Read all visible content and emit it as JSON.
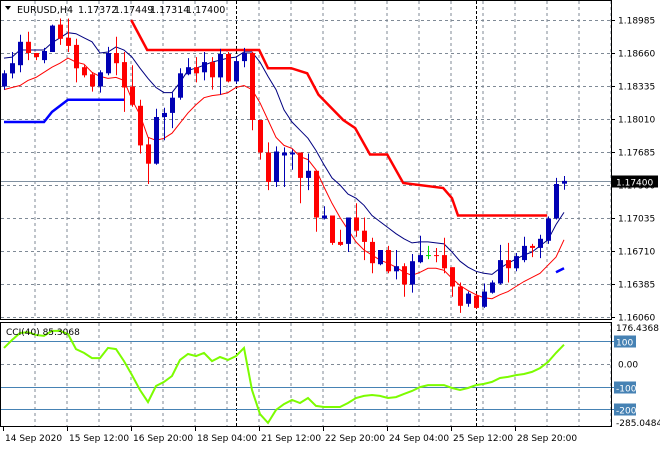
{
  "header": {
    "symbol": "EURUSD,H4",
    "open": "1.17372",
    "high": "1.17449",
    "low": "1.17314",
    "close": "1.17400"
  },
  "colors": {
    "bull": "#0000b4",
    "bear": "#ff0000",
    "doji": "#00e000",
    "ma_fast": "#000080",
    "ma_slow": "#ff0000",
    "stop_red": "#ff0000",
    "stop_blue": "#0000ff",
    "cci": "#7cfc00",
    "cci_levels": "#4682b4",
    "grid": "#7f8a96"
  },
  "chart_data": [
    {
      "type": "candlestick",
      "title": "EURUSD,H4",
      "price_ticks": [
        "1.18985",
        "1.18660",
        "1.18335",
        "1.18010",
        "1.17685",
        "1.17360",
        "1.17035",
        "1.16710",
        "1.16385",
        "1.16060"
      ],
      "ylim": [
        1.1603,
        1.1917
      ],
      "current_price_label": "1.17400",
      "current_price": 1.174,
      "x_labels": [
        {
          "index": 0,
          "text": "14 Sep 2020"
        },
        {
          "index": 8,
          "text": "15 Sep 12:00"
        },
        {
          "index": 16,
          "text": "16 Sep 20:00"
        },
        {
          "index": 24,
          "text": "18 Sep 04:00"
        },
        {
          "index": 32,
          "text": "21 Sep 12:00"
        },
        {
          "index": 40,
          "text": "22 Sep 20:00"
        },
        {
          "index": 48,
          "text": "24 Sep 04:00"
        },
        {
          "index": 56,
          "text": "25 Sep 12:00"
        },
        {
          "index": 64,
          "text": "28 Sep 20:00"
        }
      ],
      "period_separators": [
        29,
        59
      ],
      "ohlc": [
        [
          1.1833,
          1.1849,
          1.183,
          1.1846
        ],
        [
          1.1846,
          1.1867,
          1.1841,
          1.1856
        ],
        [
          1.1854,
          1.1884,
          1.1847,
          1.1877
        ],
        [
          1.1877,
          1.1887,
          1.1859,
          1.1866
        ],
        [
          1.1866,
          1.1866,
          1.1859,
          1.1862
        ],
        [
          1.1859,
          1.1871,
          1.1856,
          1.1868
        ],
        [
          1.1867,
          1.1894,
          1.1867,
          1.1893
        ],
        [
          1.1894,
          1.19,
          1.1874,
          1.188
        ],
        [
          1.1881,
          1.19,
          1.1867,
          1.1873
        ],
        [
          1.1874,
          1.188,
          1.1837,
          1.1851
        ],
        [
          1.1852,
          1.1854,
          1.1842,
          1.1844
        ],
        [
          1.1845,
          1.1847,
          1.1828,
          1.1833
        ],
        [
          1.1833,
          1.1849,
          1.1827,
          1.1847
        ],
        [
          1.1846,
          1.1872,
          1.1844,
          1.1866
        ],
        [
          1.1866,
          1.1882,
          1.1844,
          1.1856
        ],
        [
          1.1857,
          1.1867,
          1.1808,
          1.1832
        ],
        [
          1.1833,
          1.1854,
          1.1813,
          1.1815
        ],
        [
          1.1814,
          1.182,
          1.1767,
          1.1775
        ],
        [
          1.1776,
          1.1783,
          1.1737,
          1.1757
        ],
        [
          1.1757,
          1.1811,
          1.1756,
          1.1803
        ],
        [
          1.1803,
          1.1812,
          1.178,
          1.1807
        ],
        [
          1.1807,
          1.1827,
          1.1792,
          1.1822
        ],
        [
          1.1822,
          1.1851,
          1.182,
          1.1846
        ],
        [
          1.1845,
          1.1861,
          1.1844,
          1.1852
        ],
        [
          1.1852,
          1.1862,
          1.1837,
          1.1846
        ],
        [
          1.1847,
          1.1867,
          1.1839,
          1.1857
        ],
        [
          1.1857,
          1.1862,
          1.183,
          1.1842
        ],
        [
          1.1842,
          1.187,
          1.1825,
          1.1865
        ],
        [
          1.1865,
          1.1867,
          1.1837,
          1.1838
        ],
        [
          1.1838,
          1.1862,
          1.1836,
          1.1858
        ],
        [
          1.1858,
          1.1871,
          1.1852,
          1.1866
        ],
        [
          1.1866,
          1.1867,
          1.179,
          1.18
        ],
        [
          1.18,
          1.18,
          1.1761,
          1.1768
        ],
        [
          1.1768,
          1.1778,
          1.1731,
          1.1739
        ],
        [
          1.1739,
          1.1774,
          1.1734,
          1.1769
        ],
        [
          1.1765,
          1.1773,
          1.1734,
          1.1768
        ],
        [
          1.1766,
          1.1771,
          1.1751,
          1.1768
        ],
        [
          1.1768,
          1.1768,
          1.1718,
          1.1743
        ],
        [
          1.1743,
          1.1767,
          1.1731,
          1.175
        ],
        [
          1.175,
          1.175,
          1.169,
          1.1704
        ],
        [
          1.1703,
          1.1715,
          1.1702,
          1.1706
        ],
        [
          1.1706,
          1.1706,
          1.1677,
          1.1679
        ],
        [
          1.168,
          1.1692,
          1.1676,
          1.1677
        ],
        [
          1.1678,
          1.1704,
          1.167,
          1.1704
        ],
        [
          1.1704,
          1.1718,
          1.1685,
          1.1691
        ],
        [
          1.1691,
          1.1704,
          1.1662,
          1.168
        ],
        [
          1.168,
          1.1684,
          1.1649,
          1.1659
        ],
        [
          1.1658,
          1.1672,
          1.1657,
          1.1672
        ],
        [
          1.1672,
          1.1676,
          1.1649,
          1.1651
        ],
        [
          1.1651,
          1.1672,
          1.1643,
          1.1656
        ],
        [
          1.1656,
          1.1659,
          1.1626,
          1.1638
        ],
        [
          1.1638,
          1.1668,
          1.163,
          1.1661
        ],
        [
          1.166,
          1.1686,
          1.1659,
          1.1667
        ],
        [
          1.1667,
          1.1676,
          1.1663,
          1.1667
        ],
        [
          1.1667,
          1.1674,
          1.166,
          1.1666
        ],
        [
          1.1667,
          1.1684,
          1.1649,
          1.1654
        ],
        [
          1.1655,
          1.1655,
          1.1626,
          1.1636
        ],
        [
          1.1636,
          1.164,
          1.161,
          1.1617
        ],
        [
          1.1619,
          1.1631,
          1.1616,
          1.1629
        ],
        [
          1.1627,
          1.1629,
          1.1614,
          1.1615
        ],
        [
          1.1616,
          1.1639,
          1.1615,
          1.1631
        ],
        [
          1.163,
          1.1642,
          1.1629,
          1.164
        ],
        [
          1.1639,
          1.1677,
          1.1638,
          1.1662
        ],
        [
          1.1662,
          1.1679,
          1.164,
          1.1654
        ],
        [
          1.1654,
          1.1669,
          1.1651,
          1.1666
        ],
        [
          1.1662,
          1.1685,
          1.166,
          1.1676
        ],
        [
          1.1676,
          1.1678,
          1.1665,
          1.1674
        ],
        [
          1.1674,
          1.1687,
          1.1664,
          1.1683
        ],
        [
          1.1681,
          1.1705,
          1.1678,
          1.1703
        ],
        [
          1.1703,
          1.1743,
          1.1702,
          1.1737
        ],
        [
          1.17372,
          1.17449,
          1.17314,
          1.174
        ]
      ],
      "ma_fast": [
        1.1861,
        1.1862,
        1.1869,
        1.1869,
        1.1869,
        1.1869,
        1.1876,
        1.1881,
        1.1886,
        1.1885,
        1.1881,
        1.1877,
        1.1866,
        1.1867,
        1.1872,
        1.1869,
        1.1862,
        1.1851,
        1.1841,
        1.1832,
        1.1827,
        1.1827,
        1.1837,
        1.1849,
        1.1851,
        1.1854,
        1.1857,
        1.1859,
        1.1861,
        1.1862,
        1.1867,
        1.1867,
        1.1857,
        1.1843,
        1.183,
        1.181,
        1.1798,
        1.179,
        1.1782,
        1.177,
        1.1756,
        1.1743,
        1.1736,
        1.1727,
        1.1723,
        1.1716,
        1.1706,
        1.17,
        1.1694,
        1.1688,
        1.1683,
        1.1679,
        1.168,
        1.168,
        1.1679,
        1.1678,
        1.167,
        1.1661,
        1.1655,
        1.1651,
        1.1649,
        1.1648,
        1.1654,
        1.1659,
        1.1663,
        1.1667,
        1.167,
        1.1676,
        1.1682,
        1.1697,
        1.1709
      ],
      "ma_slow": [
        1.183,
        1.1832,
        1.1834,
        1.1839,
        1.1842,
        1.1847,
        1.1852,
        1.1856,
        1.1861,
        1.1857,
        1.1855,
        1.1847,
        1.1843,
        1.1841,
        1.1842,
        1.1839,
        1.182,
        1.1805,
        1.1783,
        1.178,
        1.1782,
        1.1787,
        1.1797,
        1.1807,
        1.1815,
        1.1822,
        1.1824,
        1.1825,
        1.1827,
        1.1832,
        1.1834,
        1.183,
        1.1817,
        1.18,
        1.1783,
        1.1775,
        1.1772,
        1.1764,
        1.1761,
        1.1751,
        1.1734,
        1.1718,
        1.1704,
        1.1692,
        1.168,
        1.1672,
        1.1667,
        1.1662,
        1.1659,
        1.1655,
        1.165,
        1.1647,
        1.165,
        1.1654,
        1.1654,
        1.1652,
        1.1644,
        1.1637,
        1.1632,
        1.1628,
        1.1625,
        1.1624,
        1.1628,
        1.1631,
        1.1636,
        1.1641,
        1.1645,
        1.1649,
        1.1657,
        1.1665,
        1.1682
      ],
      "stop_red": [
        [
          15.9,
          1.18985
        ],
        [
          17.9,
          1.1869
        ],
        [
          31.9,
          1.1869
        ],
        [
          33,
          1.1851
        ],
        [
          35.9,
          1.1851
        ],
        [
          37.9,
          1.1846
        ],
        [
          39.3,
          1.1825
        ],
        [
          42.4,
          1.18
        ],
        [
          43.9,
          1.1792
        ],
        [
          45.75,
          1.1766
        ],
        [
          47.9,
          1.1766
        ],
        [
          49.9,
          1.1738
        ],
        [
          54.9,
          1.1733
        ],
        [
          56,
          1.1723
        ],
        [
          56.75,
          1.1706
        ],
        [
          67.9,
          1.1706
        ]
      ],
      "stop_blue": [
        [
          [
            0,
            1.1798
          ],
          [
            5,
            1.1798
          ],
          [
            6,
            1.1808
          ],
          [
            8,
            1.182
          ],
          [
            15,
            1.182
          ]
        ],
        [
          [
            69,
            1.165
          ],
          [
            70,
            1.1654
          ]
        ]
      ]
    },
    {
      "type": "line",
      "title": "CCI(40) 85.3068",
      "label": "CCI(40)",
      "last_value": "85.3068",
      "scale_max": "176.4368",
      "scale_min": "-285.0484",
      "ylim": [
        -285.0484,
        176.4368
      ],
      "levels": [
        {
          "value": 100,
          "label": "100"
        },
        {
          "value": 0,
          "label": "0.00"
        },
        {
          "value": -100,
          "label": "-100"
        },
        {
          "value": -200,
          "label": "-200"
        }
      ],
      "values": [
        71,
        106,
        137,
        141,
        128,
        124,
        146,
        146,
        132,
        66,
        49,
        26,
        26,
        71,
        66,
        13,
        -49,
        -115,
        -168,
        -97,
        -79,
        -53,
        18,
        44,
        35,
        49,
        13,
        31,
        18,
        35,
        71,
        -115,
        -221,
        -260,
        -203,
        -177,
        -159,
        -172,
        -150,
        -185,
        -190,
        -190,
        -190,
        -172,
        -150,
        -141,
        -137,
        -141,
        -150,
        -146,
        -132,
        -119,
        -102,
        -93,
        -93,
        -93,
        -106,
        -115,
        -106,
        -93,
        -88,
        -79,
        -62,
        -57,
        -49,
        -44,
        -35,
        -18,
        9,
        49,
        85.3
      ]
    }
  ]
}
